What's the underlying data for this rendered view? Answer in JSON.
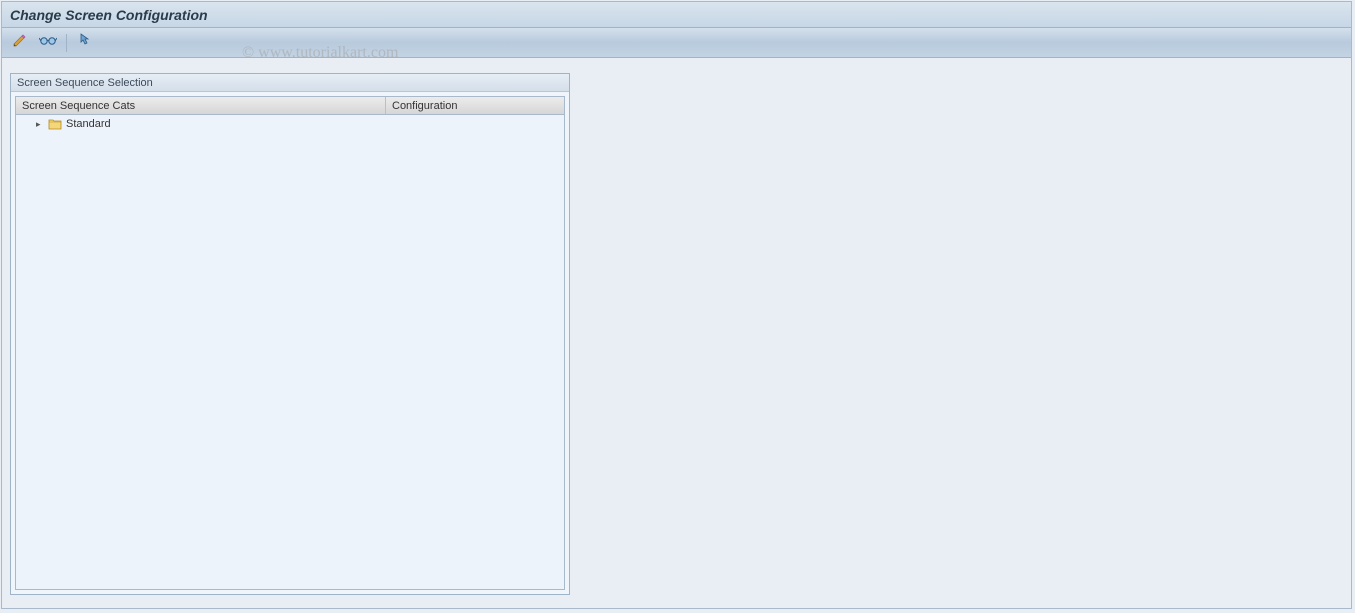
{
  "header": {
    "title": "Change Screen Configuration"
  },
  "toolbar": {
    "icons": {
      "pencil": "pencil-icon",
      "glasses": "display-icon",
      "hand": "pointer-icon"
    }
  },
  "panel": {
    "title": "Screen Sequence Selection",
    "columns": {
      "col1": "Screen Sequence Cats",
      "col2": "Configuration"
    },
    "tree": {
      "item0": {
        "label": "Standard"
      }
    }
  },
  "watermark": "© www.tutorialkart.com"
}
